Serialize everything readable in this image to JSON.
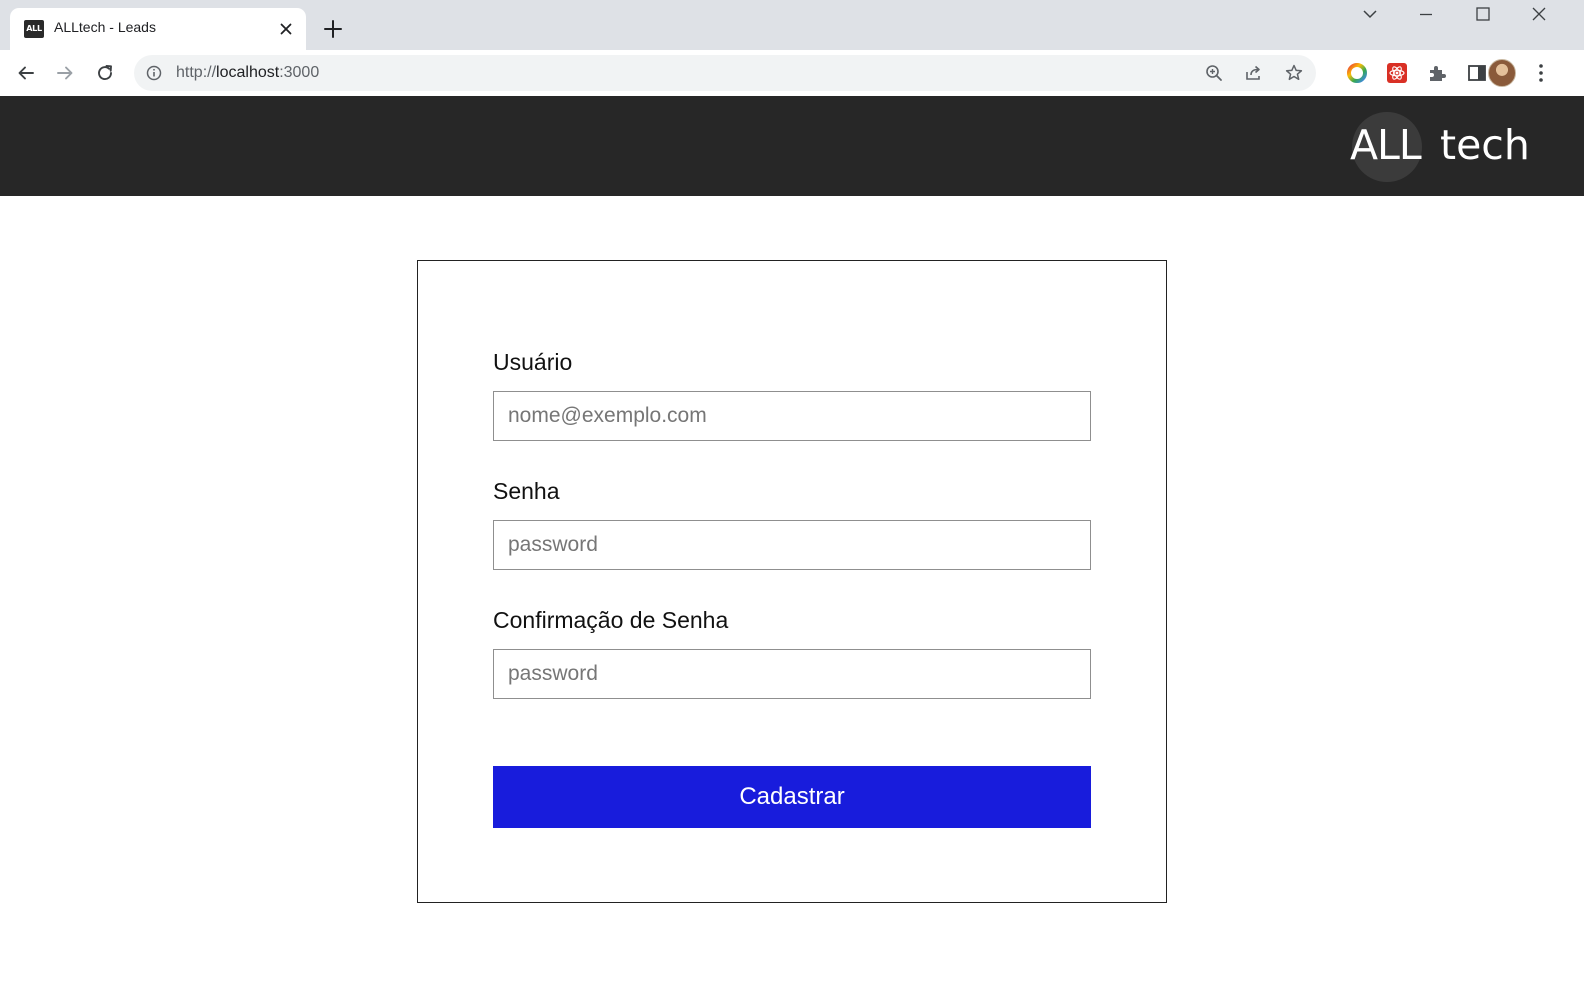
{
  "browser": {
    "tab": {
      "favicon_text": "ALL",
      "title": "ALLtech - Leads"
    },
    "url": {
      "scheme": "http://",
      "host": "localhost",
      "port": ":3000"
    }
  },
  "header": {
    "logo_part1": "ALL",
    "logo_part2": "tech"
  },
  "form": {
    "user": {
      "label": "Usuário",
      "placeholder": "nome@exemplo.com",
      "value": ""
    },
    "password": {
      "label": "Senha",
      "placeholder": "password",
      "value": ""
    },
    "confirm": {
      "label": "Confirmação de Senha",
      "placeholder": "password",
      "value": ""
    },
    "submit_label": "Cadastrar"
  },
  "colors": {
    "header_bg": "#272727",
    "button_bg": "#181cdc",
    "tabstrip_bg": "#dee1e6"
  },
  "icons": {
    "tab_close": "close-icon",
    "new_tab": "plus-icon",
    "back": "arrow-left-icon",
    "forward": "arrow-right-icon",
    "reload": "reload-icon",
    "site_info": "info-icon",
    "zoom": "zoom-icon",
    "share": "share-icon",
    "bookmark": "star-icon",
    "extensions": "puzzle-icon",
    "side_panel": "side-panel-icon",
    "menu": "kebab-menu-icon"
  }
}
